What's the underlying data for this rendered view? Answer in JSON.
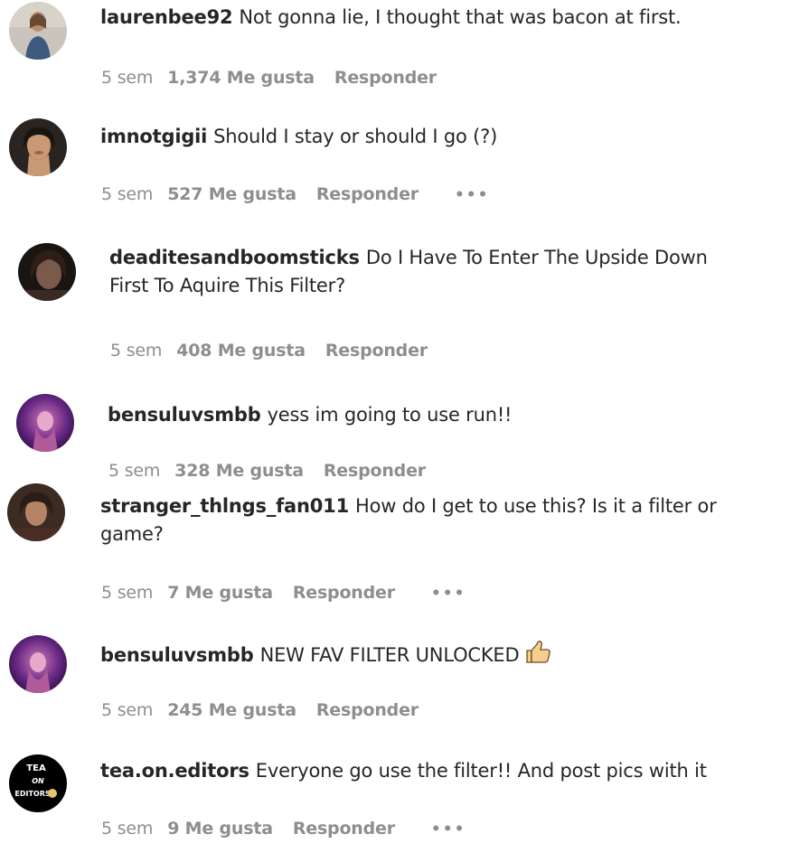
{
  "comments": [
    {
      "username": "laurenbee92",
      "text": "Not gonna lie, I thought that was bacon at first.",
      "time": "5 sem",
      "likes": "1,374 Me gusta",
      "reply": "Responder",
      "more": ""
    },
    {
      "username": "imnotgigii",
      "text": "Should I stay or should I go (?)",
      "time": "5 sem",
      "likes": "527 Me gusta",
      "reply": "Responder",
      "more": "•••"
    },
    {
      "username": "deaditesandboomsticks",
      "text": "Do I Have To Enter The Upside Down",
      "text2": "First To Aquire This Filter?",
      "time": "5 sem",
      "likes": "408 Me gusta",
      "reply": "Responder",
      "more": ""
    },
    {
      "username": "bensuluvsmbb",
      "text": "yess im going to use run!!",
      "time": "5 sem",
      "likes": "328 Me gusta",
      "reply": "Responder",
      "more": ""
    },
    {
      "username": "stranger_thlngs_fan011",
      "text": "How do I get to use this? Is it a filter or",
      "text2": "game?",
      "time": "5 sem",
      "likes": "7 Me gusta",
      "reply": "Responder",
      "more": "•••"
    },
    {
      "username": "bensuluvsmbb",
      "text": "NEW FAV FILTER UNLOCKED",
      "emoji": "thumbs-up-icon",
      "time": "5 sem",
      "likes": "245 Me gusta",
      "reply": "Responder",
      "more": ""
    },
    {
      "username": "tea.on.editors",
      "text": "Everyone go use the filter!! And post pics with it",
      "time": "5 sem",
      "likes": "9 Me gusta",
      "reply": "Responder",
      "more": "•••",
      "avatar_text1": "TEA",
      "avatar_text2": "ON",
      "avatar_text3": "EDITORS"
    }
  ]
}
